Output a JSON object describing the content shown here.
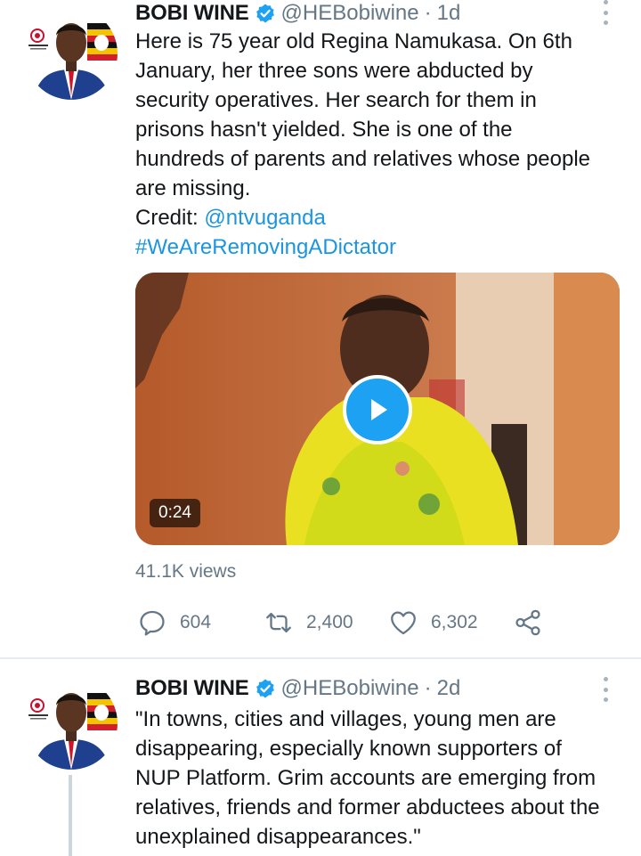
{
  "colors": {
    "link": "#1b95e0",
    "verified": "#1da1f2",
    "secondary": "#657786",
    "play_button": "#1da1f2"
  },
  "tweets": [
    {
      "name": "BOBI WINE",
      "handle": "@HEBobiwine",
      "separator": "·",
      "time": "1d",
      "text_lines": [
        "Here is 75 year old Regina Namukasa. On 6th",
        "January, her three sons were abducted by",
        "security operatives. Her search for them in",
        "prisons hasn't yielded. She is one of the",
        "hundreds of parents and relatives whose people",
        "are missing."
      ],
      "credit_label": "Credit: ",
      "credit_mention": "@ntvuganda",
      "hashtag": "#WeAreRemovingADictator",
      "media": {
        "duration": "0:24",
        "icon": "play-icon"
      },
      "views": "41.1K views",
      "actions": {
        "replies": "604",
        "retweets": "2,400",
        "likes": "6,302"
      }
    },
    {
      "name": "BOBI WINE",
      "handle": "@HEBobiwine",
      "separator": "·",
      "time": "2d",
      "text_lines": [
        "\"In towns, cities and villages, young men are",
        "disappearing, especially known supporters of",
        "NUP Platform. Grim accounts are emerging from",
        "relatives, friends and former abductees about the",
        "unexplained disappearances.\""
      ]
    }
  ]
}
